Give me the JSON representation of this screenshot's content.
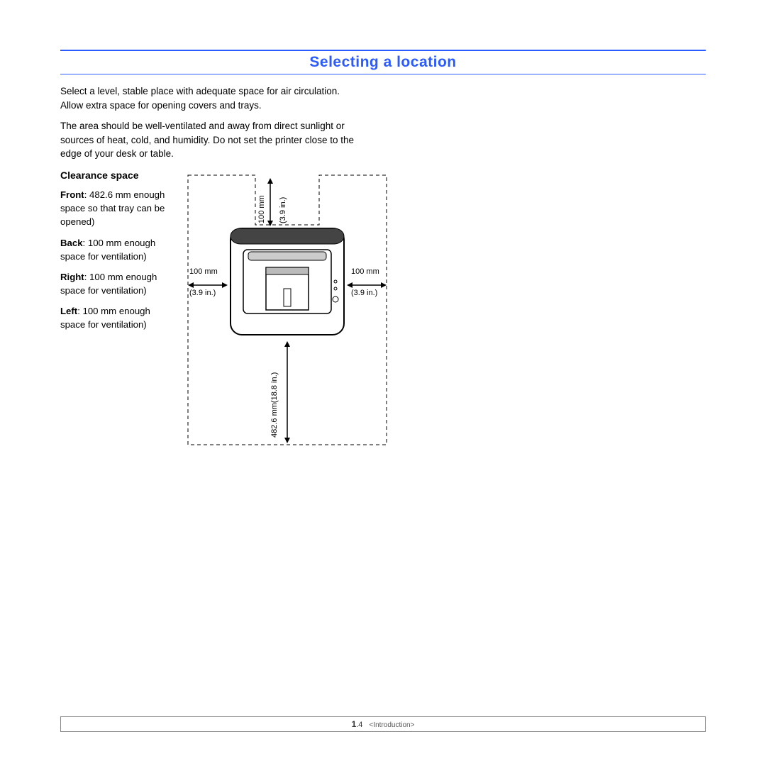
{
  "heading": "Selecting a location",
  "para1": "Select a level, stable place with adequate space for air circulation. Allow extra space for opening covers and trays.",
  "para2": "The area should be well-ventilated and away from direct sunlight or sources of heat, cold, and humidity. Do not set the printer close to the edge of your desk or table.",
  "clearance": {
    "subhead": "Clearance space",
    "front_label": "Front",
    "front_text": ": 482.6 mm enough space so that tray can be opened)",
    "back_label": "Back",
    "back_text": ": 100 mm enough space for ventilation)",
    "right_label": "Right",
    "right_text": ": 100 mm enough space for ventilation)",
    "left_label": "Left",
    "left_text": ": 100 mm enough space for ventilation)"
  },
  "diagram": {
    "top_mm": "100 mm",
    "top_in": "(3.9 in.)",
    "left_mm": "100 mm",
    "left_in": "(3.9 in.)",
    "right_mm": "100 mm",
    "right_in": "(3.9 in.)",
    "front_combined": "482.6 mm(18.8 in.)"
  },
  "footer": {
    "chapter": "1",
    "page": ".4",
    "section": "<Introduction>"
  }
}
